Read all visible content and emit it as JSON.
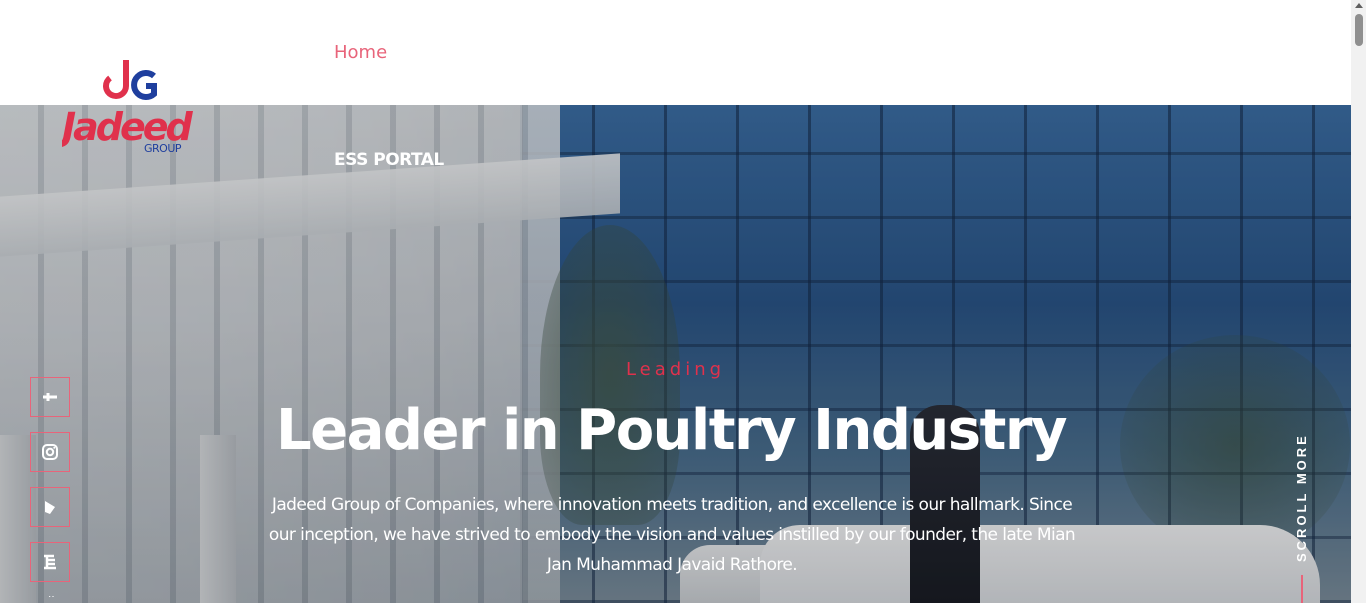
{
  "nav": {
    "home_label": "Home",
    "ess_portal_label": "ESS PORTAL"
  },
  "logo": {
    "brand": "Jadeed",
    "sub": "GROUP",
    "colors": {
      "primary": "#e0314c",
      "secondary": "#1f3f9e"
    }
  },
  "hero": {
    "eyebrow": "Leading",
    "headline": "Leader in Poultry Industry",
    "description": "Jadeed Group of Companies, where innovation meets tradition, and excellence is our hallmark. Since our inception, we have strived to embody the vision and values instilled by our founder, the late Mian Jan Muhammad Javaid Rathore.",
    "scroll_label": "SCROLL MORE"
  },
  "social": [
    {
      "icon": "facebook-icon"
    },
    {
      "icon": "instagram-icon"
    },
    {
      "icon": "tiktok-icon"
    },
    {
      "icon": "linkedin-icon"
    }
  ],
  "colors": {
    "accent": "#e8647a",
    "eyebrow": "#e0314c"
  }
}
